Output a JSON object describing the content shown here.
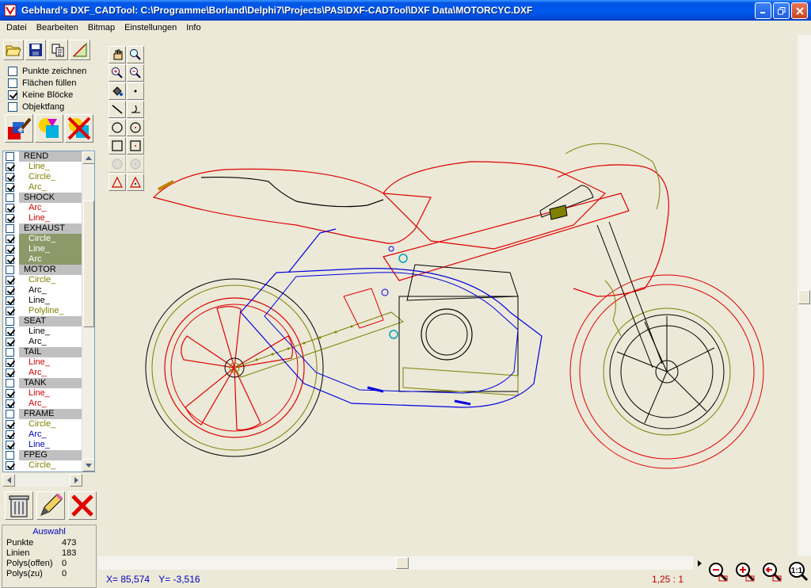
{
  "window": {
    "title": "Gebhard's DXF_CADTool: C:\\Programme\\Borland\\Delphi7\\Projects\\PAS\\DXF-CADTool\\DXF Data\\MOTORCYC.DXF"
  },
  "menu": [
    "Datei",
    "Bearbeiten",
    "Bitmap",
    "Einstellungen",
    "Info"
  ],
  "options": [
    {
      "label": "Punkte zeichnen",
      "checked": false
    },
    {
      "label": "Flächen füllen",
      "checked": false
    },
    {
      "label": "Keine Blöcke",
      "checked": true
    },
    {
      "label": "Objektfang",
      "checked": false
    }
  ],
  "layers": [
    {
      "t": "layer",
      "name": "REND",
      "checked": false
    },
    {
      "t": "ent",
      "name": "Line_",
      "color": "#808000",
      "checked": true
    },
    {
      "t": "ent",
      "name": "Circle_",
      "color": "#808000",
      "checked": true
    },
    {
      "t": "ent",
      "name": "Arc_",
      "color": "#808000",
      "checked": true
    },
    {
      "t": "layer",
      "name": "SHOCK",
      "checked": false
    },
    {
      "t": "ent",
      "name": "Arc_",
      "color": "#d00000",
      "checked": true
    },
    {
      "t": "ent",
      "name": "Line_",
      "color": "#d00000",
      "checked": true
    },
    {
      "t": "layer",
      "name": "EXHAUST",
      "checked": false
    },
    {
      "t": "ent",
      "name": "Circle_",
      "color": "#ffffff",
      "checked": true,
      "sel": true
    },
    {
      "t": "ent",
      "name": "Line_",
      "color": "#ffffff",
      "checked": true,
      "sel": true
    },
    {
      "t": "ent",
      "name": "Arc",
      "color": "#ffffff",
      "checked": true,
      "sel": true
    },
    {
      "t": "layer",
      "name": "MOTOR",
      "checked": false
    },
    {
      "t": "ent",
      "name": "Circle_",
      "color": "#808000",
      "checked": true
    },
    {
      "t": "ent",
      "name": "Arc_",
      "color": "#000000",
      "checked": true
    },
    {
      "t": "ent",
      "name": "Line_",
      "color": "#000000",
      "checked": true
    },
    {
      "t": "ent",
      "name": "Polyline_",
      "color": "#808000",
      "checked": true
    },
    {
      "t": "layer",
      "name": "SEAT",
      "checked": false
    },
    {
      "t": "ent",
      "name": "Line_",
      "color": "#000000",
      "checked": true
    },
    {
      "t": "ent",
      "name": "Arc_",
      "color": "#000000",
      "checked": true
    },
    {
      "t": "layer",
      "name": "TAIL",
      "checked": false
    },
    {
      "t": "ent",
      "name": "Line_",
      "color": "#d00000",
      "checked": true
    },
    {
      "t": "ent",
      "name": "Arc_",
      "color": "#d00000",
      "checked": true
    },
    {
      "t": "layer",
      "name": "TANK",
      "checked": false
    },
    {
      "t": "ent",
      "name": "Line_",
      "color": "#d00000",
      "checked": true
    },
    {
      "t": "ent",
      "name": "Arc_",
      "color": "#d00000",
      "checked": true
    },
    {
      "t": "layer",
      "name": "FRAME",
      "checked": false
    },
    {
      "t": "ent",
      "name": "Circle_",
      "color": "#808000",
      "checked": true
    },
    {
      "t": "ent",
      "name": "Arc_",
      "color": "#0000c0",
      "checked": true
    },
    {
      "t": "ent",
      "name": "Line_",
      "color": "#0000c0",
      "checked": true
    },
    {
      "t": "layer",
      "name": "FPEG",
      "checked": false
    },
    {
      "t": "ent",
      "name": "Circle_",
      "color": "#808000",
      "checked": true
    }
  ],
  "info": {
    "title": "Auswahl",
    "rows": [
      {
        "k": "Punkte",
        "v": "473"
      },
      {
        "k": "Linien",
        "v": "183"
      },
      {
        "k": "Polys(offen)",
        "v": "0"
      },
      {
        "k": "Polys(zu)",
        "v": "0"
      }
    ]
  },
  "status": {
    "x": "X= 85,574",
    "y": "Y= -3,516",
    "scale": "1,25 : 1"
  },
  "zoom_label": "1:1",
  "colors": {
    "title": "#0058ee",
    "red": "#e00000",
    "blue": "#0000e0",
    "olive": "#808000"
  }
}
